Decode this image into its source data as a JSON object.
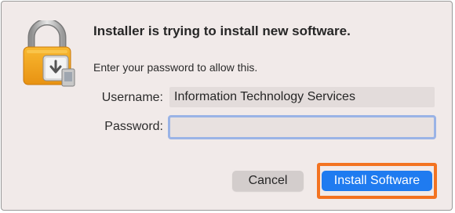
{
  "dialog": {
    "title": "Installer is trying to install new software.",
    "subtitle": "Enter your password to allow this.",
    "icon": "lock-with-installer-icon"
  },
  "form": {
    "username_label": "Username:",
    "username_value": "Information Technology Services",
    "password_label": "Password:",
    "password_value": ""
  },
  "buttons": {
    "cancel_label": "Cancel",
    "install_label": "Install Software"
  },
  "colors": {
    "accent_blue": "#1f7bf0",
    "highlight_orange": "#f37321",
    "lock_gold": "#f0a020",
    "focus_ring": "#9ab3e6",
    "dialog_background": "#f1eae9"
  }
}
